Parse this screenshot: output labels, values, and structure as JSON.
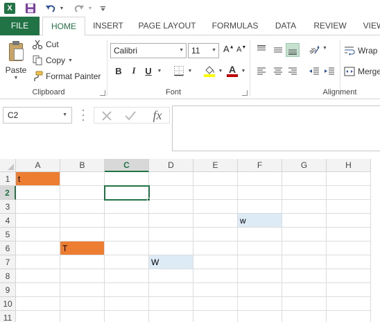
{
  "app": {
    "logo_letter": "X",
    "accent_color": "#217346"
  },
  "qat": {
    "icons": [
      "excel-logo-icon",
      "save-icon",
      "undo-icon",
      "redo-icon",
      "customize-icon"
    ]
  },
  "tabs": [
    {
      "id": "file",
      "label": "FILE"
    },
    {
      "id": "home",
      "label": "HOME",
      "active": true
    },
    {
      "id": "insert",
      "label": "INSERT"
    },
    {
      "id": "pagelayout",
      "label": "PAGE LAYOUT"
    },
    {
      "id": "formulas",
      "label": "FORMULAS"
    },
    {
      "id": "data",
      "label": "DATA"
    },
    {
      "id": "review",
      "label": "REVIEW"
    },
    {
      "id": "view",
      "label": "VIEW"
    }
  ],
  "clipboard": {
    "paste_label": "Paste",
    "cut_label": "Cut",
    "copy_label": "Copy",
    "format_painter_label": "Format Painter",
    "group_label": "Clipboard"
  },
  "font": {
    "name": "Calibri",
    "size": "11",
    "bold_label": "B",
    "italic_label": "I",
    "underline_label": "U",
    "grow_label": "A",
    "shrink_label": "A",
    "font_color_label": "A",
    "group_label": "Font",
    "fill_color": "#ffff00",
    "font_color": "#c00000"
  },
  "alignment": {
    "wrap_label": "Wrap",
    "merge_label": "Merge",
    "group_label": "Alignment"
  },
  "formula_bar": {
    "name_box": "C2",
    "fx_label": "fx",
    "formula": ""
  },
  "sheet": {
    "columns": [
      "A",
      "B",
      "C",
      "D",
      "E",
      "F",
      "G",
      "H"
    ],
    "rows": [
      "1",
      "2",
      "3",
      "4",
      "5",
      "6",
      "7",
      "8",
      "9",
      "10",
      "11"
    ],
    "active_column": "C",
    "active_row": "2",
    "cells": [
      {
        "ref": "A1",
        "value": "t",
        "fill": "#ed7d31"
      },
      {
        "ref": "F4",
        "value": "w",
        "fill": "#ddebf7"
      },
      {
        "ref": "B6",
        "value": "T",
        "fill": "#ed7d31"
      },
      {
        "ref": "D7",
        "value": "W",
        "fill": "#ddebf7"
      }
    ]
  }
}
